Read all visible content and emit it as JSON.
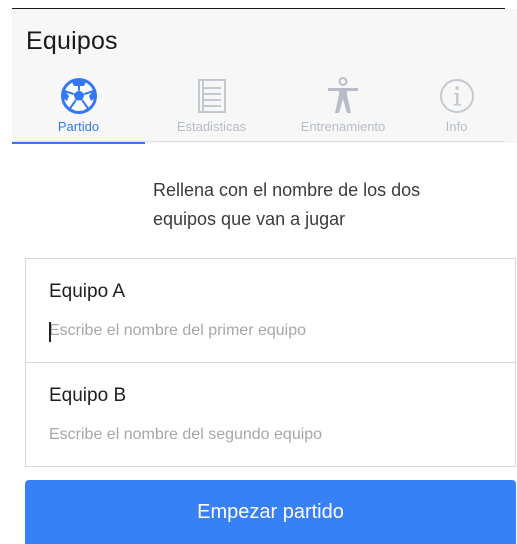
{
  "header": {
    "title": "Equipos"
  },
  "tabs": [
    {
      "label": "Partido",
      "icon": "soccer-ball-icon",
      "active": true
    },
    {
      "label": "Estadisticas",
      "icon": "stats-list-icon",
      "active": false
    },
    {
      "label": "Entrenamiento",
      "icon": "person-training-icon",
      "active": false
    },
    {
      "label": "Info",
      "icon": "info-circle-icon",
      "active": false
    }
  ],
  "instruction": "Rellena con el nombre de los dos equipos que van a jugar",
  "form": {
    "team_a": {
      "label": "Equipo A",
      "placeholder": "Escribe el nombre del primer equipo",
      "value": ""
    },
    "team_b": {
      "label": "Equipo B",
      "placeholder": "Escribe el nombre del segundo equipo",
      "value": ""
    }
  },
  "start_button": {
    "label": "Empezar partido"
  },
  "colors": {
    "accent": "#3478f6",
    "button": "#3880f6",
    "inactive_tab": "#c3c9d1"
  }
}
